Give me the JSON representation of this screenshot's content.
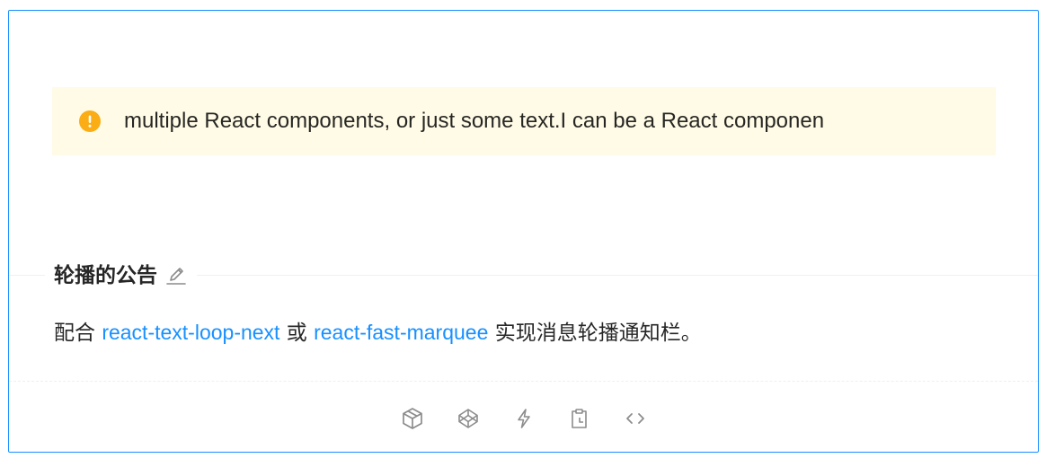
{
  "preview": {
    "alert": {
      "type": "warning",
      "icon": "exclamation-circle-icon",
      "text": "multiple React components, or just some text.I can be a React componen",
      "color": "#faad14",
      "background": "#fffbe6"
    }
  },
  "meta": {
    "title": "轮播的公告",
    "edit_icon": "edit-icon",
    "description": {
      "prefix": "配合 ",
      "link1": "react-text-loop-next",
      "middle": " 或 ",
      "link2": "react-fast-marquee",
      "suffix": " 实现消息轮播通知栏。"
    }
  },
  "actions": [
    {
      "icon": "codesandbox-icon"
    },
    {
      "icon": "codepen-icon"
    },
    {
      "icon": "thunderbolt-icon"
    },
    {
      "icon": "copy-icon"
    },
    {
      "icon": "code-expand-icon"
    }
  ],
  "colors": {
    "accent": "#1890ff",
    "icon_gray": "#8c8c8c"
  }
}
